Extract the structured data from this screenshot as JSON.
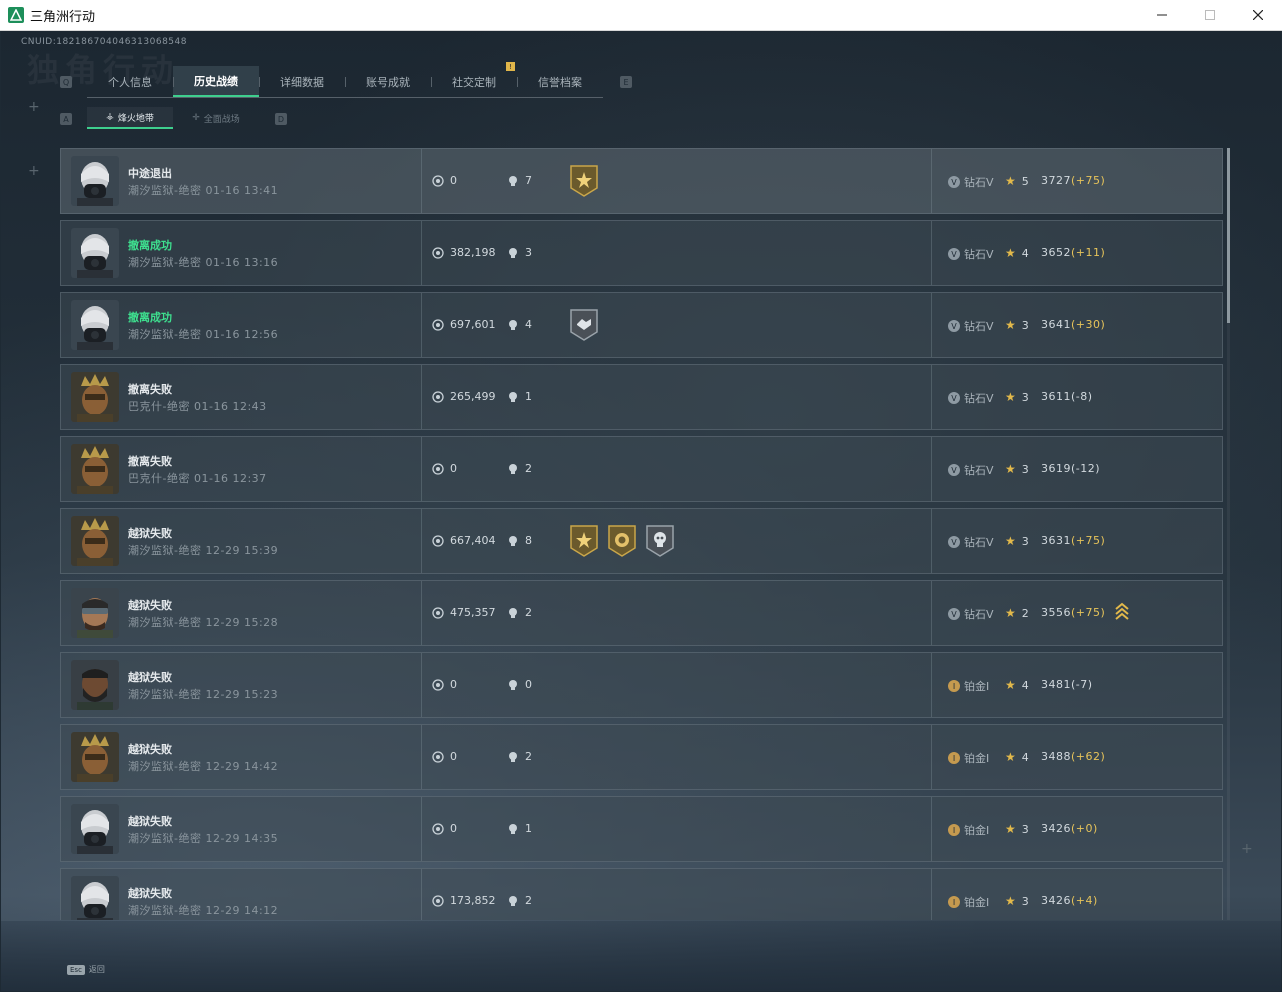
{
  "window": {
    "title": "三角洲行动",
    "minimize_icon": "minimize-icon",
    "maximize_icon": "maximize-icon",
    "close_icon": "close-icon"
  },
  "header": {
    "cnuid": "CNUID:182186704046313068548",
    "watermark": "独角行动"
  },
  "tabs": {
    "left_key": "Q",
    "right_key": "E",
    "items": [
      {
        "label": "个人信息",
        "active": false
      },
      {
        "label": "历史战绩",
        "active": true
      },
      {
        "label": "详细数据",
        "active": false
      },
      {
        "label": "账号成就",
        "active": false
      },
      {
        "label": "社交定制",
        "active": false,
        "badge": "!"
      },
      {
        "label": "信誉档案",
        "active": false
      }
    ]
  },
  "subtabs": {
    "left_key": "A",
    "right_key": "D",
    "items": [
      {
        "label": "烽火地带",
        "icon": "firezone-icon",
        "active": true
      },
      {
        "label": "全面战场",
        "icon": "battlefield-icon",
        "active": false
      }
    ]
  },
  "records": [
    {
      "result": "中途退出",
      "result_color": "#e5e9ec",
      "map": "潮汐监狱-绝密",
      "time": "01-16 13:41",
      "value": "0",
      "kills": "7",
      "medals": [
        "gold-star-medal"
      ],
      "rank": "钻石V",
      "rank_tier": "diamond",
      "stars": "5",
      "score": "3727",
      "delta": "(+75)",
      "delta_pos": true,
      "avatar": "gasmask"
    },
    {
      "result": "撤离成功",
      "result_color": "#3ee08f",
      "map": "潮汐监狱-绝密",
      "time": "01-16 13:16",
      "value": "382,198",
      "kills": "3",
      "medals": [],
      "rank": "钻石V",
      "rank_tier": "diamond",
      "stars": "4",
      "score": "3652",
      "delta": "(+11)",
      "delta_pos": true,
      "avatar": "gasmask"
    },
    {
      "result": "撤离成功",
      "result_color": "#3ee08f",
      "map": "潮汐监狱-绝密",
      "time": "01-16 12:56",
      "value": "697,601",
      "kills": "4",
      "medals": [
        "silver-handshake-medal"
      ],
      "rank": "钻石V",
      "rank_tier": "diamond",
      "stars": "3",
      "score": "3641",
      "delta": "(+30)",
      "delta_pos": true,
      "avatar": "gasmask"
    },
    {
      "result": "撤离失败",
      "result_color": "#e5e9ec",
      "map": "巴克什-绝密",
      "time": "01-16 12:43",
      "value": "265,499",
      "kills": "1",
      "medals": [],
      "rank": "钻石V",
      "rank_tier": "diamond",
      "stars": "3",
      "score": "3611",
      "delta": "(-8)",
      "delta_pos": false,
      "avatar": "crown"
    },
    {
      "result": "撤离失败",
      "result_color": "#e5e9ec",
      "map": "巴克什-绝密",
      "time": "01-16 12:37",
      "value": "0",
      "kills": "2",
      "medals": [],
      "rank": "钻石V",
      "rank_tier": "diamond",
      "stars": "3",
      "score": "3619",
      "delta": "(-12)",
      "delta_pos": false,
      "avatar": "crown"
    },
    {
      "result": "越狱失败",
      "result_color": "#e5e9ec",
      "map": "潮汐监狱-绝密",
      "time": "12-29 15:39",
      "value": "667,404",
      "kills": "8",
      "medals": [
        "gold-star-medal",
        "gold-lion-medal",
        "silver-skull-medal"
      ],
      "rank": "钻石V",
      "rank_tier": "diamond",
      "stars": "3",
      "score": "3631",
      "delta": "(+75)",
      "delta_pos": true,
      "avatar": "crown"
    },
    {
      "result": "越狱失败",
      "result_color": "#e5e9ec",
      "map": "潮汐监狱-绝密",
      "time": "12-29 15:28",
      "value": "475,357",
      "kills": "2",
      "medals": [],
      "rank": "钻石V",
      "rank_tier": "diamond",
      "stars": "2",
      "score": "3556",
      "delta": "(+75)",
      "delta_pos": true,
      "avatar": "goggles",
      "promotion": "rank-up-chevron-icon"
    },
    {
      "result": "越狱失败",
      "result_color": "#e5e9ec",
      "map": "潮汐监狱-绝密",
      "time": "12-29 15:23",
      "value": "0",
      "kills": "0",
      "medals": [],
      "rank": "铂金I",
      "rank_tier": "platinum",
      "stars": "4",
      "score": "3481",
      "delta": "(-7)",
      "delta_pos": false,
      "avatar": "beard"
    },
    {
      "result": "越狱失败",
      "result_color": "#e5e9ec",
      "map": "潮汐监狱-绝密",
      "time": "12-29 14:42",
      "value": "0",
      "kills": "2",
      "medals": [],
      "rank": "铂金I",
      "rank_tier": "platinum",
      "stars": "4",
      "score": "3488",
      "delta": "(+62)",
      "delta_pos": true,
      "avatar": "crown"
    },
    {
      "result": "越狱失败",
      "result_color": "#e5e9ec",
      "map": "潮汐监狱-绝密",
      "time": "12-29 14:35",
      "value": "0",
      "kills": "1",
      "medals": [],
      "rank": "铂金I",
      "rank_tier": "platinum",
      "stars": "3",
      "score": "3426",
      "delta": "(+0)",
      "delta_pos": true,
      "avatar": "gasmask"
    },
    {
      "result": "越狱失败",
      "result_color": "#e5e9ec",
      "map": "潮汐监狱-绝密",
      "time": "12-29 14:12",
      "value": "173,852",
      "kills": "2",
      "medals": [],
      "rank": "铂金I",
      "rank_tier": "platinum",
      "stars": "3",
      "score": "3426",
      "delta": "(+4)",
      "delta_pos": true,
      "avatar": "gasmask"
    }
  ],
  "footer": {
    "esc_key": "Esc",
    "esc_label": "返回"
  },
  "colors": {
    "accent": "#3ecf8e",
    "success": "#3ee08f",
    "gold": "#e2b94b",
    "positive_delta": "#e7c45a"
  }
}
